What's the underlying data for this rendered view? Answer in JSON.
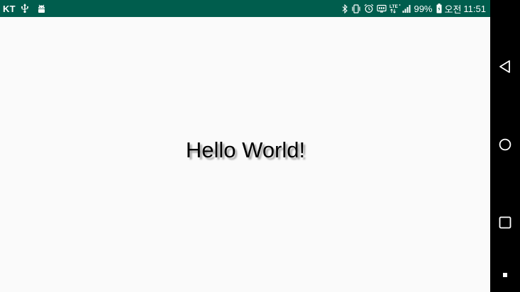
{
  "status_bar": {
    "carrier": "KT",
    "battery_percent": "99%",
    "ampm": "오전",
    "time": "11:51",
    "background_color": "#005d4d",
    "left_icons": [
      "usb-icon",
      "android-debug-icon"
    ],
    "right_icons": [
      "bluetooth-icon",
      "vibrate-icon",
      "alarm-icon",
      "volte-icon",
      "lte-icon",
      "signal-icon",
      "battery-icon"
    ],
    "lte_label": "LTE"
  },
  "main": {
    "text": "Hello World!",
    "background_color": "#fafafa"
  },
  "nav_bar": {
    "buttons": [
      "back-icon",
      "home-icon",
      "recent-apps-icon",
      "keyboard-switch-icon"
    ]
  }
}
